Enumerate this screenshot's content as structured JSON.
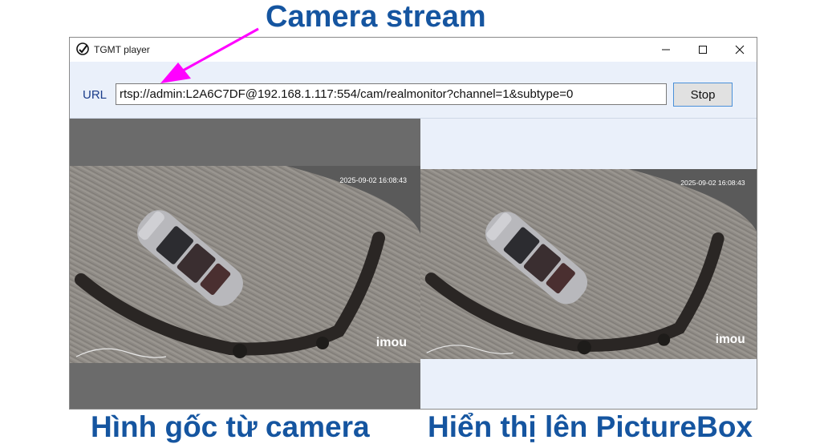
{
  "annotations": {
    "top_caption": "Camera stream",
    "left_caption": "Hình gốc từ camera",
    "right_caption": "Hiển thị lên PictureBox",
    "caption_color": "#1555a0",
    "arrow_color": "#ff00ff"
  },
  "window": {
    "title": "TGMT player",
    "icon": "app-logo-icon",
    "controls": [
      "minimize-icon",
      "maximize-icon",
      "close-icon"
    ]
  },
  "toolbar": {
    "url_label": "URL",
    "url_value": "rtsp://admin:L2A6C7DF@192.168.1.117:554/cam/realmonitor?channel=1&subtype=0",
    "stop_label": "Stop"
  },
  "feeds": {
    "original": {
      "timestamp": "2025-09-02 16:08:43",
      "watermark": "imou"
    },
    "picturebox": {
      "timestamp": "2025-09-02 16:08:43",
      "watermark": "imou"
    }
  }
}
